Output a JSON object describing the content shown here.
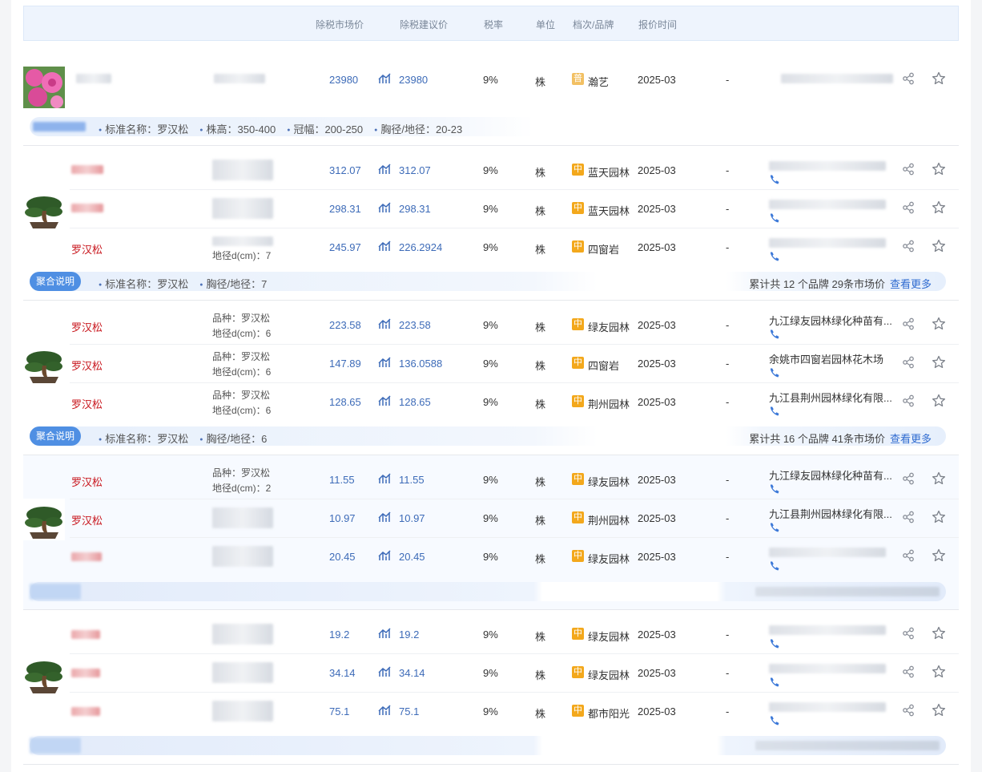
{
  "header": {
    "market_price": "除税市场价",
    "suggest_price": "除税建议价",
    "tax_rate": "税率",
    "unit": "单位",
    "grade_brand": "档次/品牌",
    "quote_time": "报价时间"
  },
  "groups": [
    {
      "image": "flower-photo",
      "rows": [
        {
          "name": "",
          "spec1": "",
          "spec2": "",
          "market_price": "23980",
          "suggest_price": "23980",
          "tax": "9%",
          "unit": "株",
          "grade": "普",
          "brand": "瀚艺",
          "date": "2025-03",
          "dash": "-",
          "supplier": ""
        }
      ],
      "summary": {
        "tag": "",
        "attrs": [
          "标准名称：罗汉松",
          "株高：350-400",
          "冠幅：200-250",
          "胸径/地径：20-23"
        ],
        "total": "",
        "more": ""
      }
    },
    {
      "image": "bonsai-pine-photo",
      "rows": [
        {
          "name": "",
          "spec1": "",
          "spec2": "",
          "market_price": "312.07",
          "suggest_price": "312.07",
          "tax": "9%",
          "unit": "株",
          "grade": "中",
          "brand": "蓝天园林",
          "date": "2025-03",
          "dash": "-",
          "supplier": ""
        },
        {
          "name": "",
          "spec1": "",
          "spec2": "",
          "market_price": "298.31",
          "suggest_price": "298.31",
          "tax": "9%",
          "unit": "株",
          "grade": "中",
          "brand": "蓝天园林",
          "date": "2025-03",
          "dash": "-",
          "supplier": ""
        },
        {
          "name": "罗汉松",
          "spec1": "",
          "spec2": "地径d(cm)：7",
          "market_price": "245.97",
          "suggest_price": "226.2924",
          "tax": "9%",
          "unit": "株",
          "grade": "中",
          "brand": "四窗岩",
          "date": "2025-03",
          "dash": "-",
          "supplier": ""
        }
      ],
      "summary": {
        "tag": "聚合说明",
        "attrs": [
          "标准名称：罗汉松",
          "胸径/地径：7"
        ],
        "total": "累计共 12 个品牌 29条市场价",
        "more": "查看更多"
      }
    },
    {
      "image": "bonsai-pine-photo",
      "rows": [
        {
          "name": "罗汉松",
          "spec1": "品种：罗汉松",
          "spec2": "地径d(cm)：6",
          "market_price": "223.58",
          "suggest_price": "223.58",
          "tax": "9%",
          "unit": "株",
          "grade": "中",
          "brand": "绿友园林",
          "date": "2025-03",
          "dash": "-",
          "supplier": "九江绿友园林绿化种苗有..."
        },
        {
          "name": "罗汉松",
          "spec1": "品种：罗汉松",
          "spec2": "地径d(cm)：6",
          "market_price": "147.89",
          "suggest_price": "136.0588",
          "tax": "9%",
          "unit": "株",
          "grade": "中",
          "brand": "四窗岩",
          "date": "2025-03",
          "dash": "-",
          "supplier": "余姚市四窗岩园林花木场"
        },
        {
          "name": "罗汉松",
          "spec1": "品种：罗汉松",
          "spec2": "地径d(cm)：6",
          "market_price": "128.65",
          "suggest_price": "128.65",
          "tax": "9%",
          "unit": "株",
          "grade": "中",
          "brand": "荆州园林",
          "date": "2025-03",
          "dash": "-",
          "supplier": "九江县荆州园林绿化有限..."
        }
      ],
      "summary": {
        "tag": "聚合说明",
        "attrs": [
          "标准名称：罗汉松",
          "胸径/地径：6"
        ],
        "total": "累计共 16 个品牌 41条市场价",
        "more": "查看更多"
      }
    },
    {
      "image": "bonsai-pine-photo",
      "rows": [
        {
          "name": "罗汉松",
          "spec1": "品种：罗汉松",
          "spec2": "地径d(cm)：2",
          "market_price": "11.55",
          "suggest_price": "11.55",
          "tax": "9%",
          "unit": "株",
          "grade": "中",
          "brand": "绿友园林",
          "date": "2025-03",
          "dash": "-",
          "supplier": "九江绿友园林绿化种苗有..."
        },
        {
          "name": "罗汉松",
          "spec1": "",
          "spec2": "",
          "market_price": "10.97",
          "suggest_price": "10.97",
          "tax": "9%",
          "unit": "株",
          "grade": "中",
          "brand": "荆州园林",
          "date": "2025-03",
          "dash": "-",
          "supplier": "九江县荆州园林绿化有限..."
        },
        {
          "name": "",
          "spec1": "",
          "spec2": "",
          "market_price": "20.45",
          "suggest_price": "20.45",
          "tax": "9%",
          "unit": "株",
          "grade": "中",
          "brand": "绿友园林",
          "date": "2025-03",
          "dash": "-",
          "supplier": ""
        }
      ],
      "summary": {
        "tag": "",
        "attrs": [],
        "total": "",
        "more": ""
      }
    },
    {
      "image": "bonsai-pine-photo",
      "rows": [
        {
          "name": "",
          "spec1": "",
          "spec2": "",
          "market_price": "19.2",
          "suggest_price": "19.2",
          "tax": "9%",
          "unit": "株",
          "grade": "中",
          "brand": "绿友园林",
          "date": "2025-03",
          "dash": "-",
          "supplier": ""
        },
        {
          "name": "",
          "spec1": "",
          "spec2": "",
          "market_price": "34.14",
          "suggest_price": "34.14",
          "tax": "9%",
          "unit": "株",
          "grade": "中",
          "brand": "绿友园林",
          "date": "2025-03",
          "dash": "-",
          "supplier": ""
        },
        {
          "name": "",
          "spec1": "",
          "spec2": "",
          "market_price": "75.1",
          "suggest_price": "75.1",
          "tax": "9%",
          "unit": "株",
          "grade": "中",
          "brand": "都市阳光",
          "date": "2025-03",
          "dash": "-",
          "supplier": ""
        }
      ],
      "summary": {
        "tag": "",
        "attrs": [],
        "total": "",
        "more": ""
      }
    }
  ],
  "colors": {
    "accent": "#4f8fe3",
    "price": "#3d6bb8",
    "name": "#c8161d",
    "badge_mid": "#f3a81c",
    "badge_common": "#f2c063"
  }
}
